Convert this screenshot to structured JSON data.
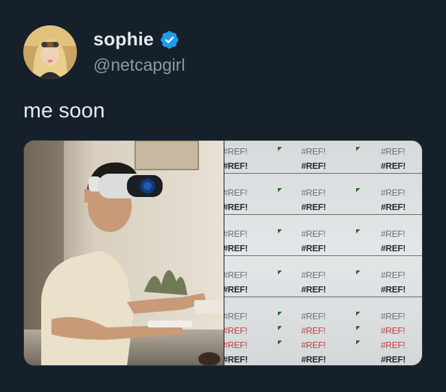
{
  "user": {
    "display_name": "sophie",
    "handle": "@netcapgirl",
    "avatar_icon": "avatar-photo",
    "verified_icon": "verified-badge-icon"
  },
  "tweet": {
    "text": "me soon"
  },
  "media": {
    "left_image": "man-wearing-vr-headset-typing-photo",
    "right_image": "spreadsheet-ref-errors-photo",
    "ref_text": "#REF!",
    "rows": [
      {
        "cells": [
          "#REF!",
          "#REF!",
          "#REF!"
        ],
        "style": "light"
      },
      {
        "cells": [
          "#REF!",
          "#REF!",
          "#REF!"
        ],
        "style": "bold"
      },
      {
        "cells": [
          "#REF!",
          "#REF!",
          "#REF!"
        ],
        "style": "light"
      },
      {
        "cells": [
          "#REF!",
          "#REF!",
          "#REF!"
        ],
        "style": "bold"
      },
      {
        "cells": [
          "#REF!",
          "#REF!",
          "#REF!"
        ],
        "style": "light"
      },
      {
        "cells": [
          "#REF!",
          "#REF!",
          "#REF!"
        ],
        "style": "bold"
      },
      {
        "cells": [
          "#REF!",
          "#REF!",
          "#REF!"
        ],
        "style": "light"
      },
      {
        "cells": [
          "#REF!",
          "#REF!",
          "#REF!"
        ],
        "style": "bold"
      },
      {
        "cells": [
          "#REF!",
          "#REF!",
          "#REF!"
        ],
        "style": "light"
      },
      {
        "cells": [
          "#REF!",
          "#REF!",
          "#REF!"
        ],
        "style": "red"
      },
      {
        "cells": [
          "#REF!",
          "#REF!",
          "#REF!"
        ],
        "style": "red"
      },
      {
        "cells": [
          "#REF!",
          "#REF!",
          "#REF!"
        ],
        "style": "bold"
      }
    ]
  },
  "colors": {
    "background": "#15202b",
    "verified_blue": "#1d9bf0",
    "handle_gray": "#8b98a5"
  }
}
